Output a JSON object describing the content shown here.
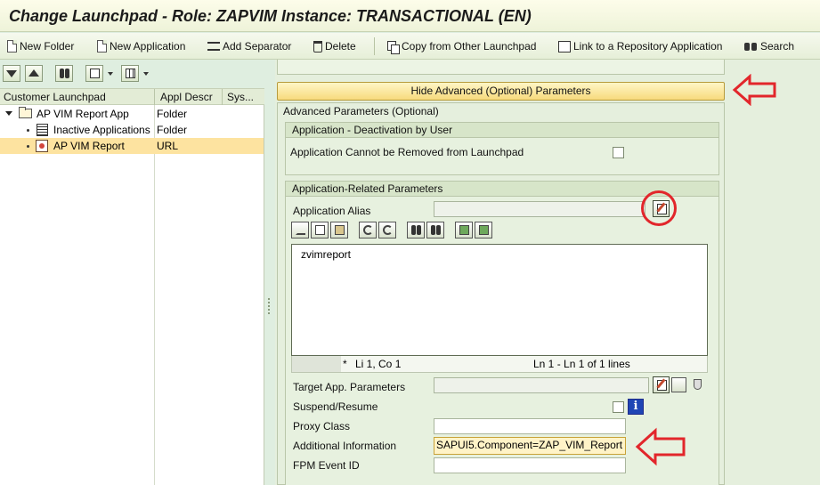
{
  "window": {
    "title": "Change Launchpad - Role: ZAPVIM Instance: TRANSACTIONAL (EN)"
  },
  "toolbar": {
    "new_folder": "New Folder",
    "new_application": "New Application",
    "add_separator": "Add Separator",
    "delete": "Delete",
    "copy_from_other": "Copy from Other Launchpad",
    "link_repository": "Link to a Repository Application",
    "search": "Search"
  },
  "tree": {
    "columns": [
      "Customer Launchpad",
      "Appl Descr",
      "Sys..."
    ],
    "rows": [
      {
        "label": "AP VIM Report App",
        "desc": "Folder",
        "icon": "folder-icon"
      },
      {
        "label": "Inactive Applications",
        "desc": "Folder",
        "icon": "list-icon"
      },
      {
        "label": "AP VIM Report",
        "desc": "URL",
        "icon": "url-icon",
        "selected": true
      }
    ]
  },
  "right": {
    "hide_button": "Hide Advanced (Optional) Parameters",
    "advanced_title": "Advanced Parameters (Optional)",
    "deactivation": {
      "title": "Application - Deactivation by User",
      "cannot_remove_label": "Application Cannot be Removed from Launchpad",
      "cannot_remove_checked": false
    },
    "params": {
      "title": "Application-Related Parameters",
      "alias_label": "Application Alias",
      "alias_value": "",
      "editor_text": "zvimreport",
      "status_marker": "*",
      "status_pos": "Li 1, Co 1",
      "status_lines": "Ln 1 - Ln 1 of 1 lines",
      "target_label": "Target App. Parameters",
      "target_value": "",
      "suspend_label": "Suspend/Resume",
      "suspend_checked": false,
      "proxy_label": "Proxy Class",
      "proxy_value": "",
      "additional_label": "Additional Information",
      "additional_value": "SAPUI5.Component=ZAP_VIM_Report",
      "fpm_label": "FPM Event ID",
      "fpm_value": ""
    }
  },
  "colors": {
    "annotation": "#e2262b",
    "selection": "#fde3a0",
    "button": "#f7da7d"
  }
}
